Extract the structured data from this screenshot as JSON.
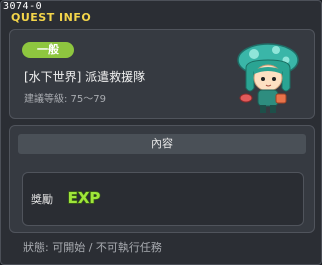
{
  "quest": {
    "id": "3074-0",
    "window_title": "QUEST INFO",
    "category_badge": "一般",
    "name": "[水下世界] 派遣救援隊",
    "level_range": "建議等級: 75〜79"
  },
  "content": {
    "header": "內容",
    "reward_label": "獎勵",
    "reward_type_icon": "exp-icon"
  },
  "status": {
    "text": "狀態: 可開始 / 不可執行任務"
  },
  "colors": {
    "title": "#f4d54a",
    "badge": "#8ec63f",
    "exp": "#9fe63a"
  }
}
